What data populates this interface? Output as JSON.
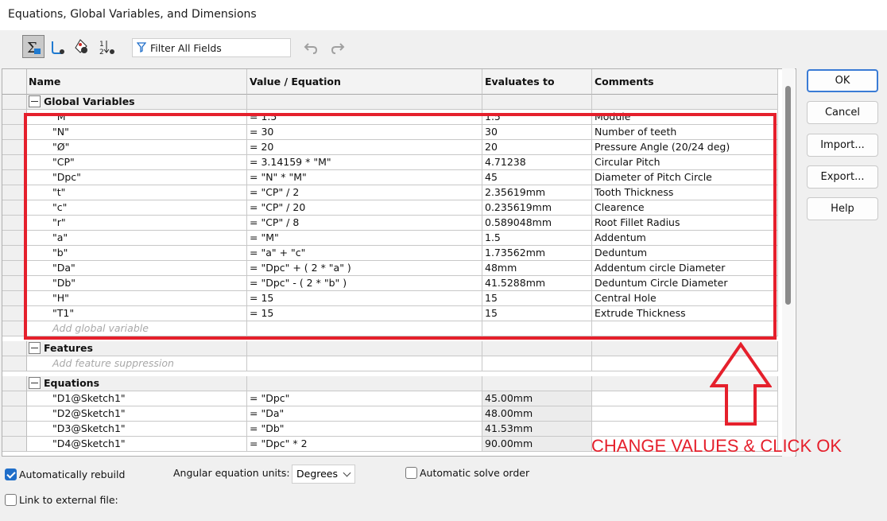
{
  "window": {
    "title": "Equations, Global Variables, and Dimensions"
  },
  "toolbar": {
    "filter_text": "Filter All Fields",
    "buttons": [
      "equation-view-icon",
      "sketch-view-icon",
      "dimension-view-icon",
      "ordered-view-icon"
    ]
  },
  "columns": {
    "name": "Name",
    "value": "Value / Equation",
    "evaluates": "Evaluates to",
    "comments": "Comments"
  },
  "sections": {
    "global": "Global Variables",
    "features": "Features",
    "equations": "Equations"
  },
  "global_vars": [
    {
      "name": "\"M\"",
      "value": "= 1.5",
      "eval": "1.5",
      "comment": "Module"
    },
    {
      "name": "\"N\"",
      "value": "= 30",
      "eval": "30",
      "comment": "Number of teeth"
    },
    {
      "name": "\"Ø\"",
      "value": "= 20",
      "eval": "20",
      "comment": "Pressure Angle (20/24 deg)"
    },
    {
      "name": "\"CP\"",
      "value": "= 3.14159 * \"M\"",
      "eval": "4.71238",
      "comment": "Circular Pitch"
    },
    {
      "name": "\"Dpc\"",
      "value": "= \"N\" * \"M\"",
      "eval": "45",
      "comment": "Diameter of Pitch Circle"
    },
    {
      "name": "\"t\"",
      "value": "= \"CP\" / 2",
      "eval": "2.35619mm",
      "comment": "Tooth Thickness"
    },
    {
      "name": "\"c\"",
      "value": "= \"CP\" / 20",
      "eval": "0.235619mm",
      "comment": "Clearence"
    },
    {
      "name": "\"r\"",
      "value": "= \"CP\" / 8",
      "eval": "0.589048mm",
      "comment": "Root Fillet Radius"
    },
    {
      "name": "\"a\"",
      "value": "= \"M\"",
      "eval": "1.5",
      "comment": "Addentum"
    },
    {
      "name": "\"b\"",
      "value": "= \"a\" + \"c\"",
      "eval": "1.73562mm",
      "comment": "Deduntum"
    },
    {
      "name": "\"Da\"",
      "value": "= \"Dpc\" + ( 2 * \"a\" )",
      "eval": "48mm",
      "comment": "Addentum circle Diameter"
    },
    {
      "name": "\"Db\"",
      "value": "= \"Dpc\" - ( 2 * \"b\" )",
      "eval": "41.5288mm",
      "comment": "Deduntum Circle Diameter"
    },
    {
      "name": "\"H\"",
      "value": "= 15",
      "eval": "15",
      "comment": "Central Hole"
    },
    {
      "name": "\"T1\"",
      "value": "= 15",
      "eval": "15",
      "comment": "Extrude Thickness"
    }
  ],
  "add_global": "Add global variable",
  "add_feature": "Add feature suppression",
  "equations": [
    {
      "name": "\"D1@Sketch1\"",
      "value": "= \"Dpc\"",
      "eval": "45.00mm",
      "comment": ""
    },
    {
      "name": "\"D2@Sketch1\"",
      "value": "= \"Da\"",
      "eval": "48.00mm",
      "comment": ""
    },
    {
      "name": "\"D3@Sketch1\"",
      "value": "= \"Db\"",
      "eval": "41.53mm",
      "comment": ""
    },
    {
      "name": "\"D4@Sketch1\"",
      "value": "= \"Dpc\" * 2",
      "eval": "90.00mm",
      "comment": ""
    }
  ],
  "dialog_buttons": {
    "ok": "OK",
    "cancel": "Cancel",
    "import": "Import...",
    "export": "Export...",
    "help": "Help"
  },
  "options": {
    "auto_rebuild": "Automatically rebuild",
    "angular_units_label": "Angular equation units:",
    "angular_units_value": "Degrees",
    "auto_solve": "Automatic solve order",
    "link_external": "Link to external file:"
  },
  "annotation": {
    "text": "CHANGE VALUES & CLICK OK",
    "color": "#e5202c"
  }
}
